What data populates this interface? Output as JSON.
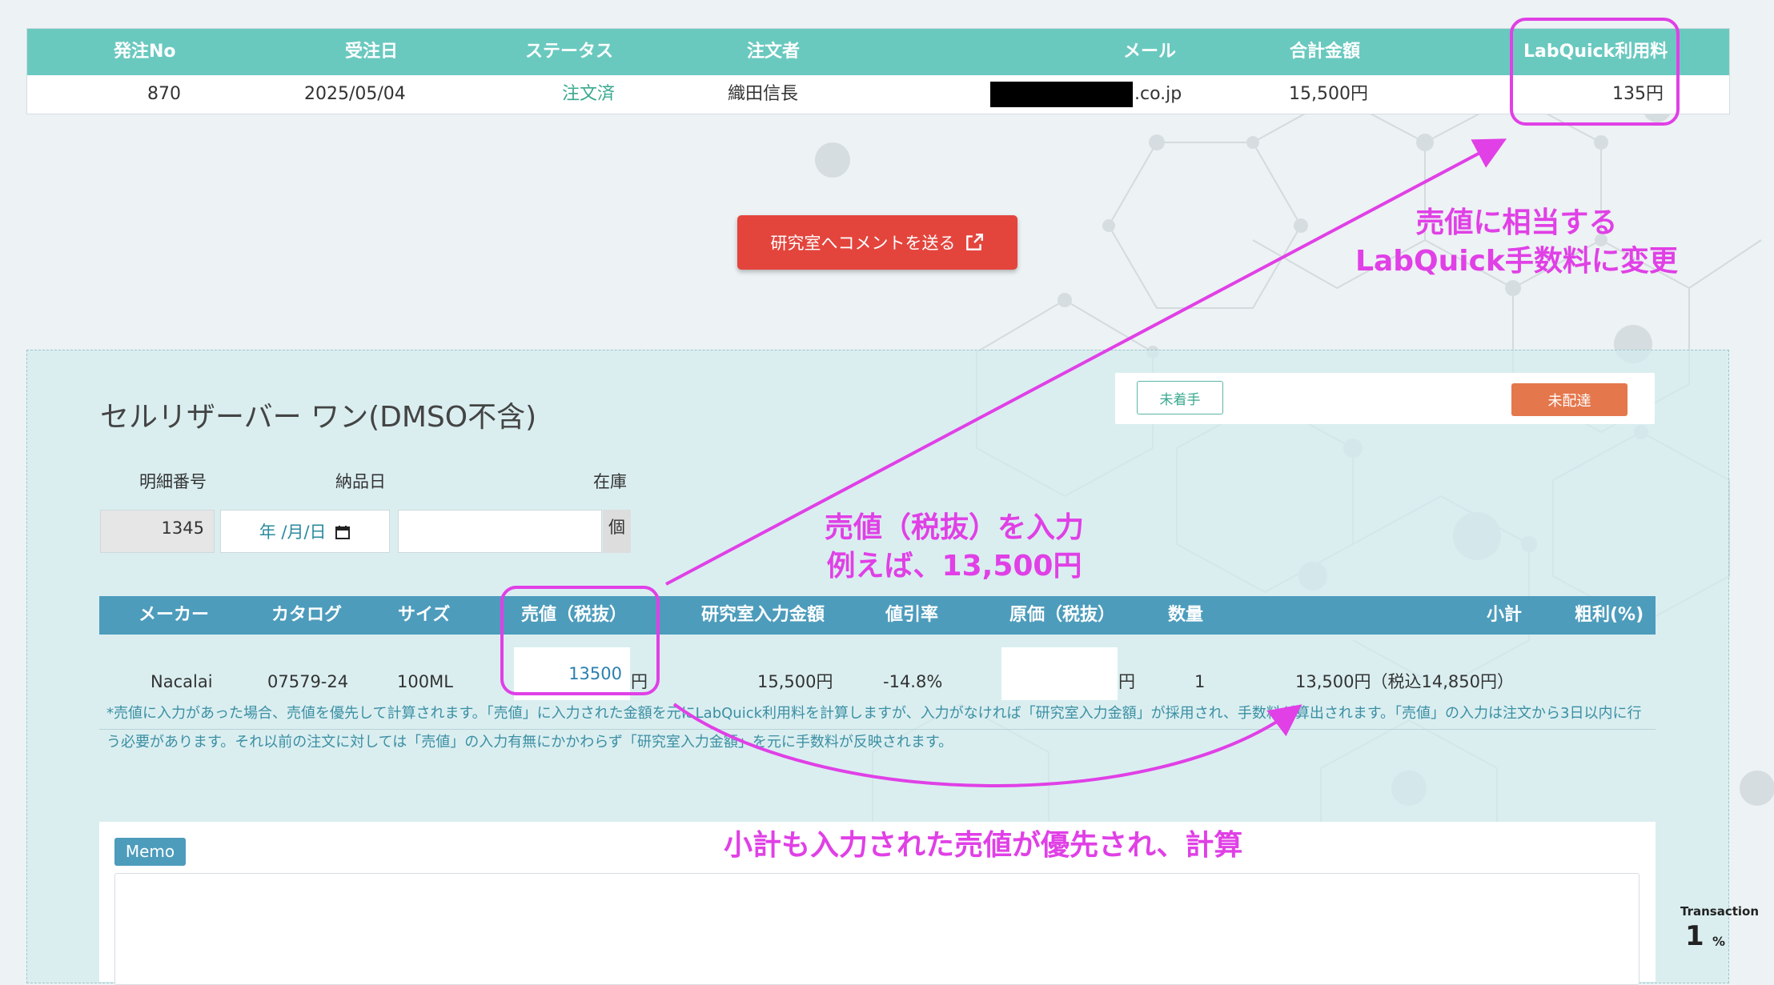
{
  "order_table": {
    "headers": [
      "発注No",
      "受注日",
      "ステータス",
      "注文者",
      "メール",
      "合計金額",
      "LabQuick利用料"
    ],
    "row": {
      "order_no": "870",
      "received_date": "2025/05/04",
      "status": "注文済",
      "orderer": "織田信長",
      "email_suffix": ".co.jp",
      "total": "15,500円",
      "labquick_fee": "135円"
    }
  },
  "comment_button": {
    "label": "研究室へコメントを送る",
    "icon": "external-link-icon"
  },
  "product": {
    "title": "セルリザーバー ワン(DMSO不含)",
    "status_buttons": {
      "unstarted": "未着手",
      "undelivered": "未配達"
    },
    "fields": {
      "detail_no_label": "明細番号",
      "delivery_date_label": "納品日",
      "stock_label": "在庫",
      "detail_no_value": "1345",
      "date_placeholder": "年 /月/日",
      "stock_unit": "個"
    },
    "item_table": {
      "headers": [
        "メーカー",
        "カタログ",
        "サイズ",
        "売値（税抜）",
        "研究室入力金額",
        "値引率",
        "原価（税抜）",
        "数量",
        "小計",
        "粗利(%)"
      ],
      "row": {
        "maker": "Nacalai",
        "catalog": "07579-24",
        "size": "100ML",
        "sale_price": "13500",
        "yen": "円",
        "lab_amount": "15,500円",
        "discount": "-14.8%",
        "cost_unit": "円",
        "qty": "1",
        "subtotal": "13,500円（税込14,850円）"
      }
    },
    "note": "*売値に入力があった場合、売値を優先して計算されます。「売値」に入力された金額を元にLabQuick利用料を計算しますが、入力がなければ「研究室入力金額」が採用され、手数料が算出されます。「売値」の入力は注文から3日以内に行う必要があります。それ以前の注文に対しては「売値」の入力有無にかかわらず「研究室入力金額」を元に手数料が反映されます。"
  },
  "memo": {
    "label": "Memo"
  },
  "transaction": {
    "label": "Transaction",
    "value": "1",
    "unit": "%"
  },
  "annotations": {
    "fee": [
      "売値に相当する",
      "LabQuick手数料に変更"
    ],
    "price": [
      "売値（税抜）を入力",
      "例えば、13,500円"
    ],
    "subtotal": "小計も入力された売値が優先され、計算"
  },
  "colors": {
    "order_header": "#6ac9bf",
    "item_header": "#4d9cbc",
    "comment_button": "#e3453d",
    "undelivered_button": "#e4774c",
    "annotation": "#e040e6",
    "status_text": "#3aa88f"
  }
}
